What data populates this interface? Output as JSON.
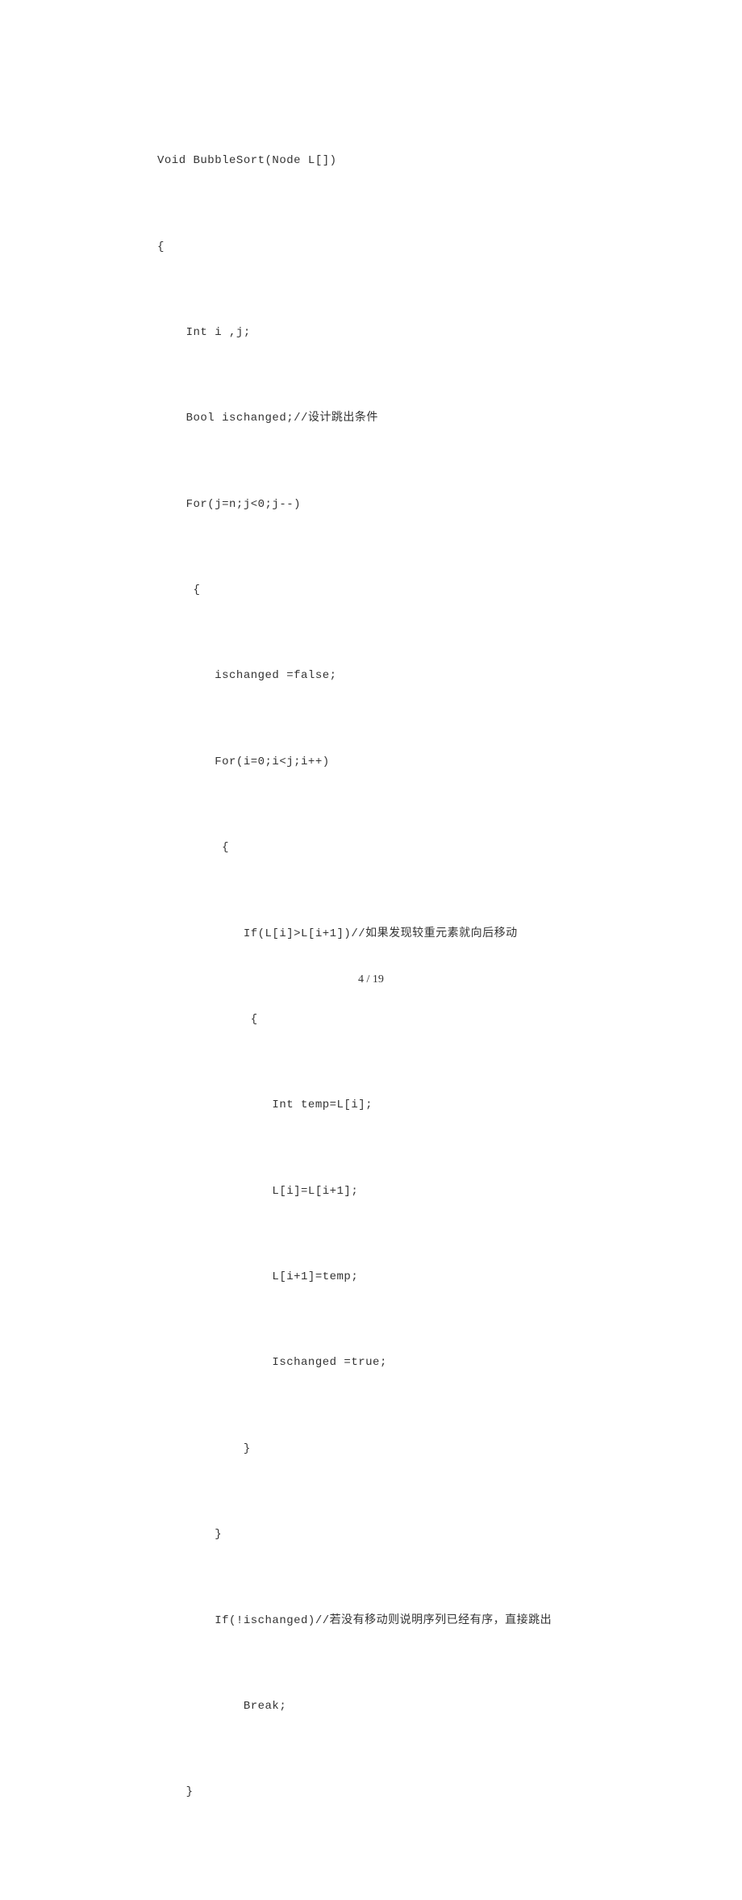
{
  "code": {
    "l0": "Void BubbleSort(Node L[])",
    "l1": "{",
    "l2": "    Int i ,j;",
    "l3": "    Bool ischanged;//设计跳出条件",
    "l4": "    For(j=n;j<0;j--)",
    "l5": "     {",
    "l6": "        ischanged =false;",
    "l7": "        For(i=0;i<j;i++)",
    "l8": "         {",
    "l9": "            If(L[i]>L[i+1])//如果发现较重元素就向后移动",
    "l10": "             {",
    "l11": "                Int temp=L[i];",
    "l12": "                L[i]=L[i+1];",
    "l13": "                L[i+1]=temp;",
    "l14": "                Ischanged =true;",
    "l15": "            }",
    "l16": "        }",
    "l17": "        If(!ischanged)//若没有移动则说明序列已经有序，直接跳出",
    "l18": "            Break;",
    "l19": "    }"
  },
  "footer": {
    "page_indicator": "4 / 19"
  }
}
